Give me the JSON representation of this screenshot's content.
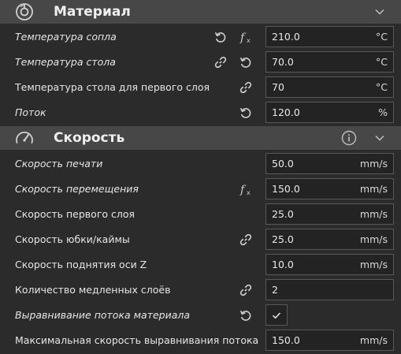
{
  "material": {
    "title": "Материал",
    "icon": "spool-icon",
    "rows": [
      {
        "label": "Температура сопла",
        "value": "210.0",
        "unit": "°C"
      },
      {
        "label": "Температура стола",
        "value": "70.0",
        "unit": "°C"
      },
      {
        "label": "Температура стола для первого слоя",
        "value": "70",
        "unit": "°C"
      },
      {
        "label": "Поток",
        "value": "120.0",
        "unit": "%"
      }
    ]
  },
  "speed": {
    "title": "Скорость",
    "icon": "speedometer-icon",
    "rows": [
      {
        "label": "Скорость печати",
        "value": "50.0",
        "unit": "mm/s"
      },
      {
        "label": "Скорость перемещения",
        "value": "150.0",
        "unit": "mm/s"
      },
      {
        "label": "Скорость первого слоя",
        "value": "25.0",
        "unit": "mm/s"
      },
      {
        "label": "Скорость юбки/каймы",
        "value": "25.0",
        "unit": "mm/s"
      },
      {
        "label": "Скорость поднятия оси Z",
        "value": "10.0",
        "unit": "mm/s"
      },
      {
        "label": "Количество медленных слоёв",
        "value": "2",
        "unit": ""
      },
      {
        "label": "Выравнивание потока материала",
        "checked": true
      },
      {
        "label": "Максимальная скорость выравнивания потока",
        "value": "150.0",
        "unit": "mm/s"
      }
    ]
  },
  "colors": {
    "background": "#2b2b2b",
    "header": "#474747",
    "field": "#232323",
    "border": "#585858"
  }
}
